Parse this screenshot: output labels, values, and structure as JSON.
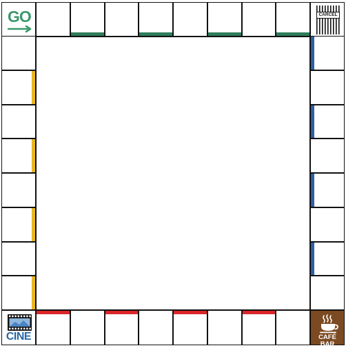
{
  "colors": {
    "border": "#111111",
    "green": "#2e7d5b",
    "blue": "#2d5fa6",
    "yellow": "#e8b824",
    "red": "#d9262b",
    "go": "#3b9a6c",
    "cine": "#2767a8",
    "cafe": "#7b4a22"
  },
  "corners": {
    "go": {
      "label": "GO",
      "icon": "right-arrow-icon"
    },
    "jail": {
      "label": "CARCEL",
      "icon": "prison-bars-icon"
    },
    "cinema": {
      "label": "CINE",
      "icon": "film-strip-icon"
    },
    "cafe": {
      "label": "CAFÉ BAR",
      "icon": "coffee-cup-icon"
    }
  },
  "board": {
    "cells_per_side": 8,
    "top_color_group": "green",
    "right_color_group": "blue",
    "bottom_color_group": "red",
    "left_color_group": "yellow"
  }
}
